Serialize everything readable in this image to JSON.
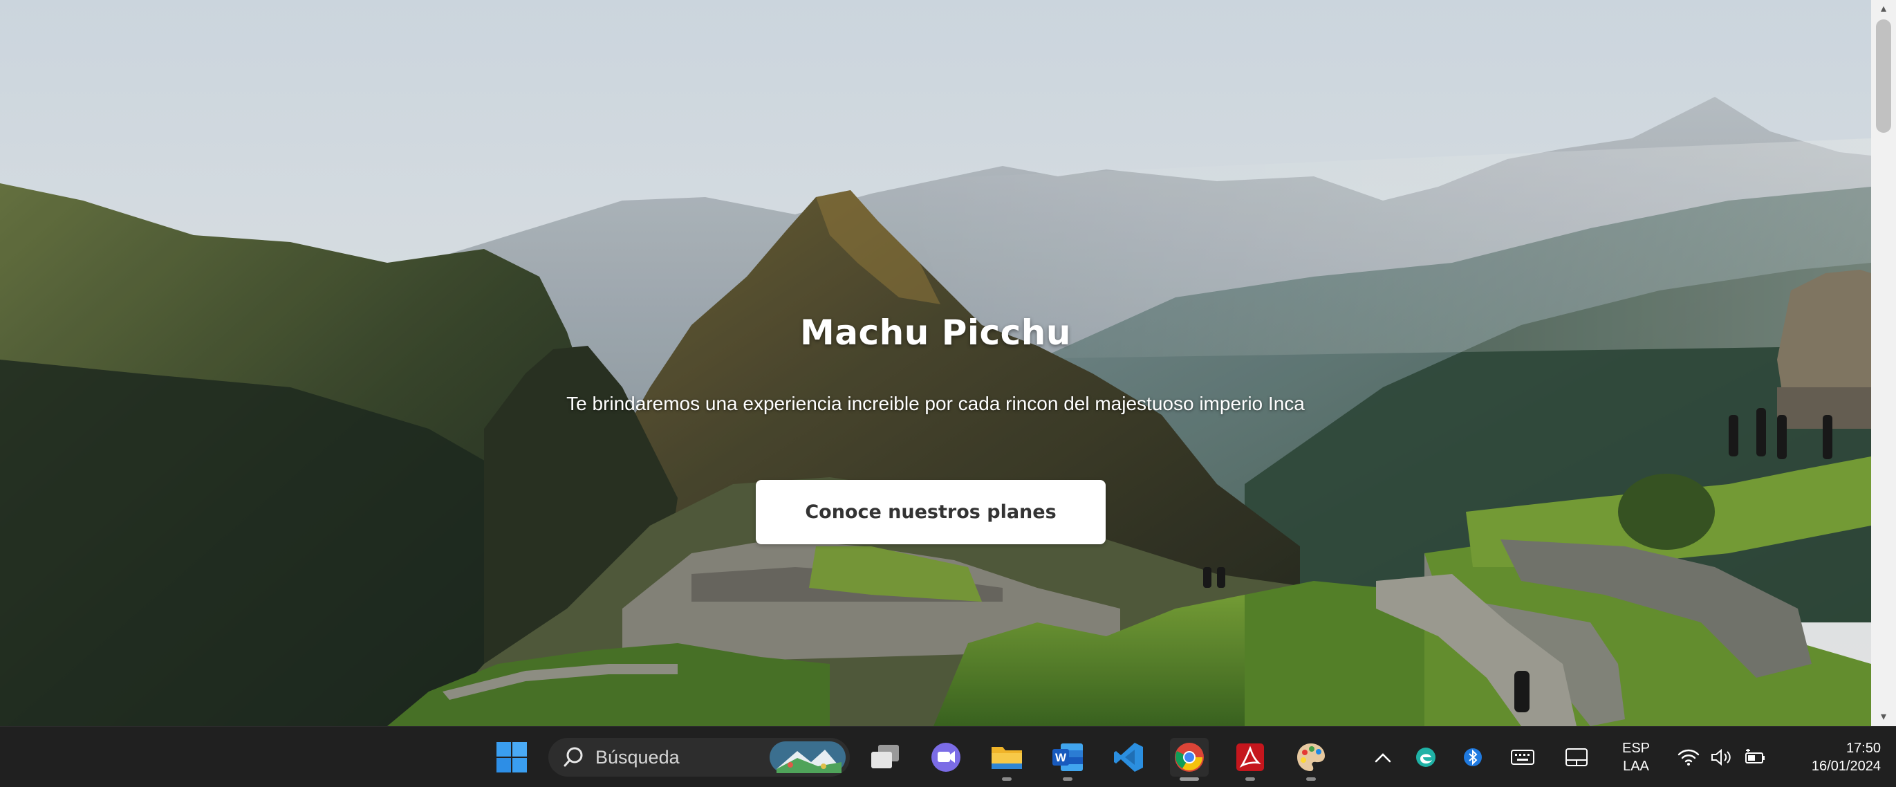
{
  "hero": {
    "title": "Machu Picchu",
    "subtitle": "Te brindaremos una experiencia increible por cada rincon del majestuoso imperio Inca",
    "cta_label": "Conoce nuestros planes"
  },
  "taskbar": {
    "search_placeholder": "Búsqueda",
    "apps": [
      "windows-start",
      "task-view",
      "teams",
      "file-explorer",
      "word",
      "vscode",
      "chrome",
      "acrobat",
      "paint"
    ],
    "language_line1": "ESP",
    "language_line2": "LAA",
    "time": "17:50",
    "date": "16/01/2024"
  },
  "colors": {
    "sky": "#e4edf3",
    "taskbar": "#202020",
    "cta_bg": "#ffffff",
    "windows_blue": "#3a9ef0",
    "vscode_blue": "#2b8fe0",
    "acrobat_red": "#c5161d"
  }
}
